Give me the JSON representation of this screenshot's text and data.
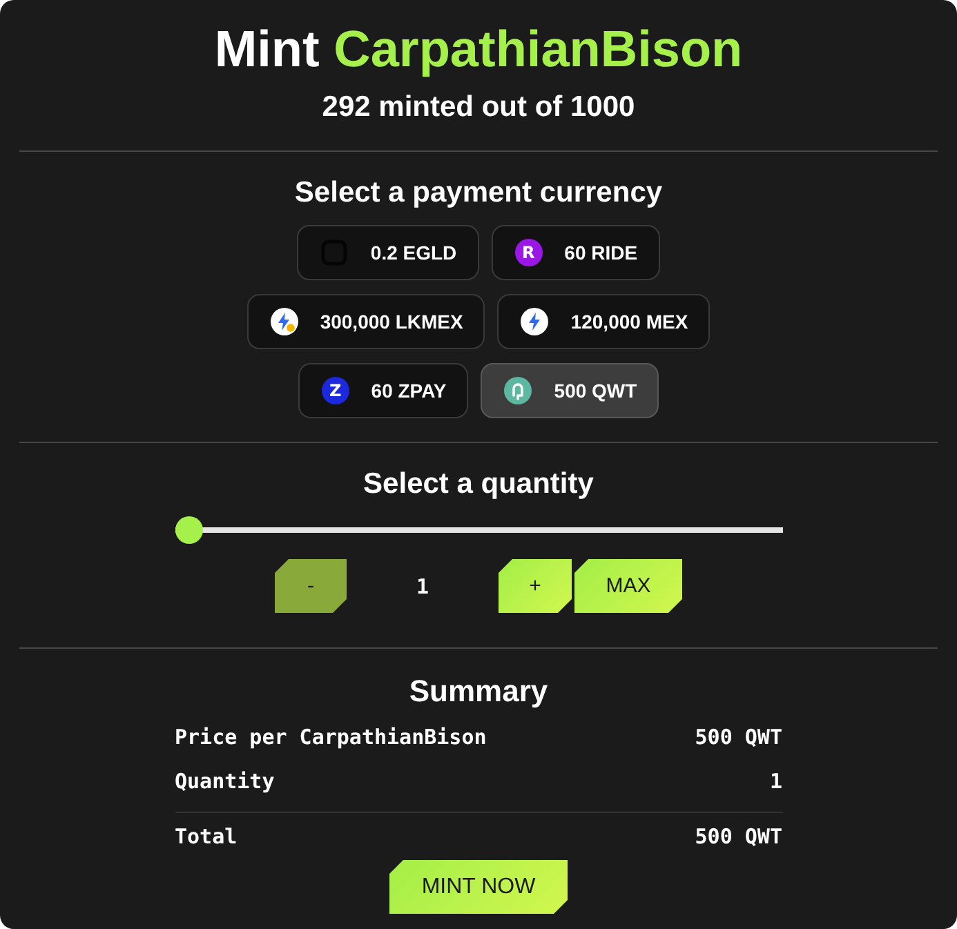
{
  "header": {
    "title_lead": "Mint",
    "title_highlight": "CarpathianBison",
    "subtitle": "292 minted out of 1000"
  },
  "currency": {
    "title": "Select a payment currency",
    "rows": [
      [
        {
          "label": "0.2 EGLD",
          "kind": "frame",
          "selected": false
        },
        {
          "label": "60 RIDE",
          "kind": "letter",
          "glyph": "R",
          "color": "#9b17e6",
          "selected": false
        }
      ],
      [
        {
          "label": "300,000 LKMEX",
          "kind": "bolt-coin",
          "selected": false
        },
        {
          "label": "120,000 MEX",
          "kind": "bolt",
          "selected": false
        }
      ],
      [
        {
          "label": "60 ZPAY",
          "kind": "letter",
          "glyph": "Z",
          "color": "#1c28dc",
          "selected": false
        },
        {
          "label": "500 QWT",
          "kind": "loop",
          "selected": true
        }
      ]
    ]
  },
  "quantity": {
    "title": "Select a quantity",
    "slider": {
      "level": 0
    },
    "decrement": {
      "label": "-",
      "disabled": true
    },
    "value": "1",
    "increment": {
      "label": "+",
      "disabled": false
    },
    "max_button": {
      "label": "MAX"
    }
  },
  "summary": {
    "title": "Summary",
    "rows": [
      {
        "kind": "line",
        "label": "Price per CarpathianBison",
        "value": "500 QWT"
      },
      {
        "kind": "line",
        "label": "Quantity",
        "value": "1"
      },
      {
        "kind": "total",
        "label": "Total",
        "value": "500 QWT"
      }
    ]
  },
  "mint_button": {
    "label": "MINT NOW"
  }
}
